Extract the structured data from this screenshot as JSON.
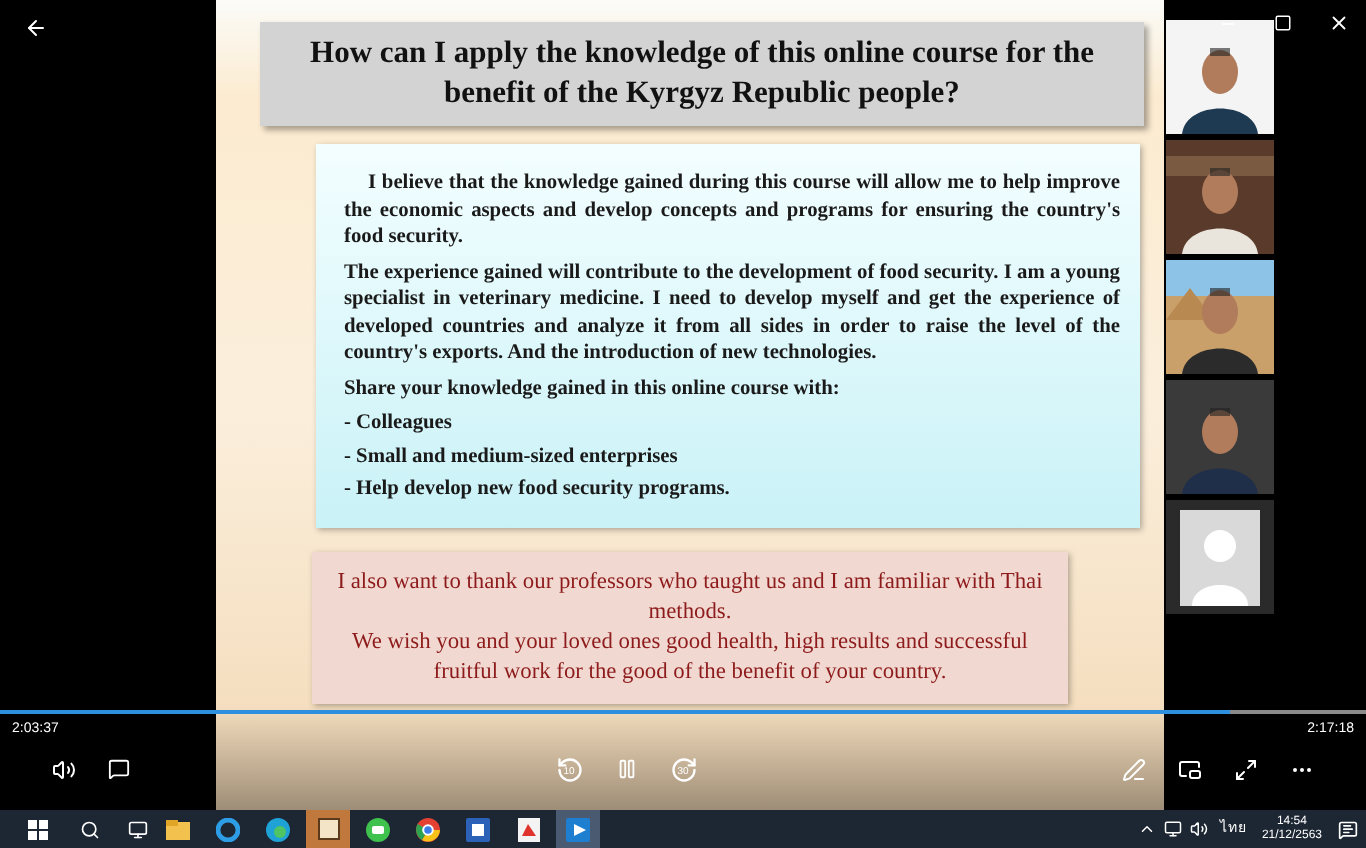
{
  "slide": {
    "title": "How can I apply the knowledge of this online course for the benefit of the Kyrgyz Republic people?",
    "paragraphs": [
      "I believe that the knowledge gained during this course will allow me to help improve the economic aspects and develop concepts and programs for ensuring the country's food security.",
      "The experience gained will contribute to the development of food security. I am a young specialist in veterinary medicine. I need to develop myself and get the experience of developed countries and analyze it from all sides in order to raise the level of the country's exports. And the introduction of new technologies.",
      "Share your knowledge gained in this online course with:"
    ],
    "list": [
      "- Colleagues",
      "- Small and medium-sized enterprises",
      "- Help develop new food security programs."
    ],
    "thanks": [
      "I also want to thank our professors who taught us and I am familiar with Thai methods.",
      "We wish you and your loved ones good health, high results and successful fruitful work for the good of the benefit of your country."
    ]
  },
  "participants": [
    {
      "kind": "video"
    },
    {
      "kind": "video"
    },
    {
      "kind": "video"
    },
    {
      "kind": "video"
    },
    {
      "kind": "avatar"
    }
  ],
  "player": {
    "elapsed": "2:03:37",
    "total": "2:17:18",
    "level": 0.9,
    "rewind_label": "10",
    "forward_label": "30",
    "playing": true
  },
  "taskbar": {
    "apps": [
      {
        "kind": "explorer",
        "selected": false
      },
      {
        "kind": "ie",
        "selected": false
      },
      {
        "kind": "edge",
        "selected": false
      },
      {
        "kind": "frame",
        "selected": true
      },
      {
        "kind": "chat",
        "selected": false
      },
      {
        "kind": "chrome",
        "selected": false
      },
      {
        "kind": "word",
        "selected": false
      },
      {
        "kind": "pdf",
        "selected": false
      },
      {
        "kind": "movies",
        "selected": true
      }
    ],
    "language": "ไทย",
    "time": "14:54",
    "date": "21/12/2563"
  }
}
